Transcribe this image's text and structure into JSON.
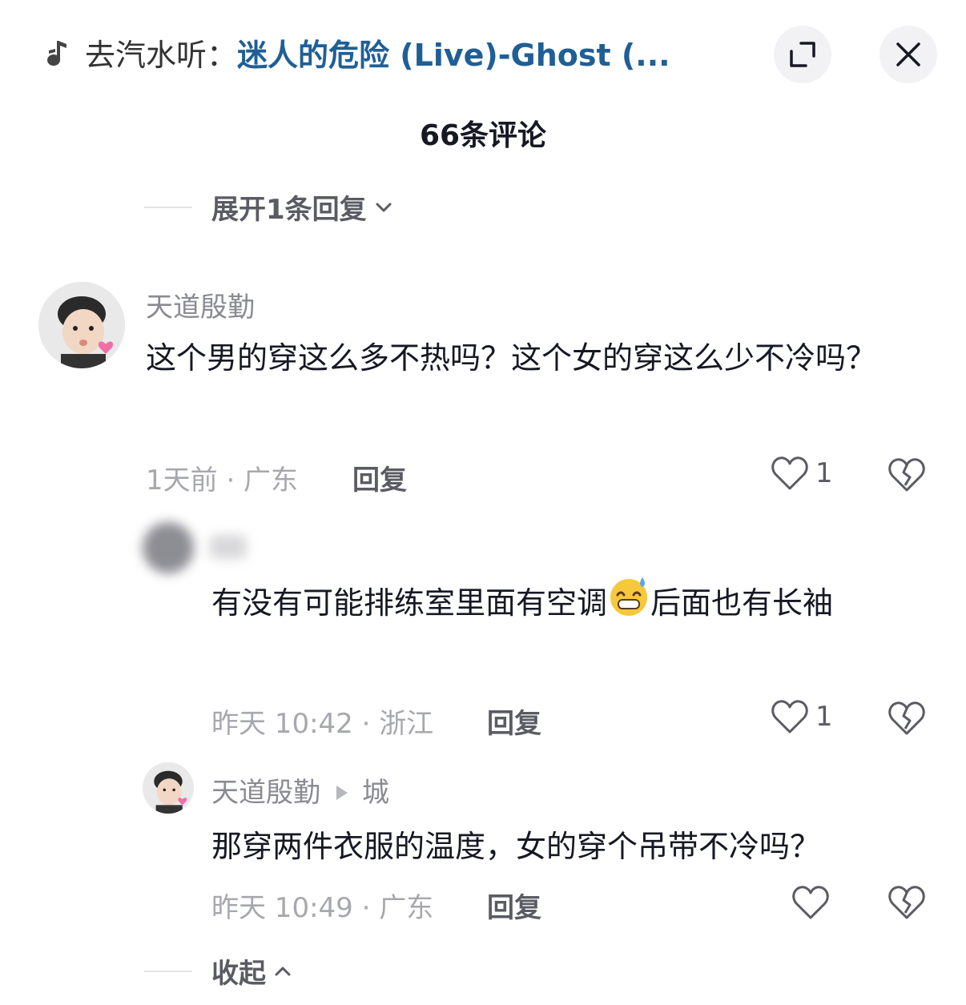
{
  "header": {
    "music_prefix": "去汽水听：",
    "music_title": "迷人的危险 (Live)-Ghost (...",
    "expand_icon": "expand-icon",
    "close_icon": "close-icon"
  },
  "comments_title": "66条评论",
  "expand_replies": "展开1条回复",
  "comments": [
    {
      "username": "天道殷勤",
      "text": "这个男的穿这么多不热吗？这个女的穿这么少不冷吗？",
      "meta": "1天前 · 广东",
      "reply_label": "回复",
      "likes": "1"
    }
  ],
  "replies": [
    {
      "username": "",
      "text_before": "有没有可能排练室里面有空调",
      "emoji": "grinning-sweat-emoji",
      "text_after": "后面也有长袖",
      "meta": "昨天 10:42 · 浙江",
      "reply_label": "回复",
      "likes": "1"
    },
    {
      "username": "天道殷勤",
      "reply_to": "城",
      "text": "那穿两件衣服的温度，女的穿个吊带不冷吗？",
      "meta": "昨天 10:49 · 广东",
      "reply_label": "回复",
      "likes": ""
    }
  ],
  "collapse_label": "收起",
  "colors": {
    "title_link": "#1f5f96",
    "muted": "#a7a8ad",
    "text": "#161823"
  }
}
